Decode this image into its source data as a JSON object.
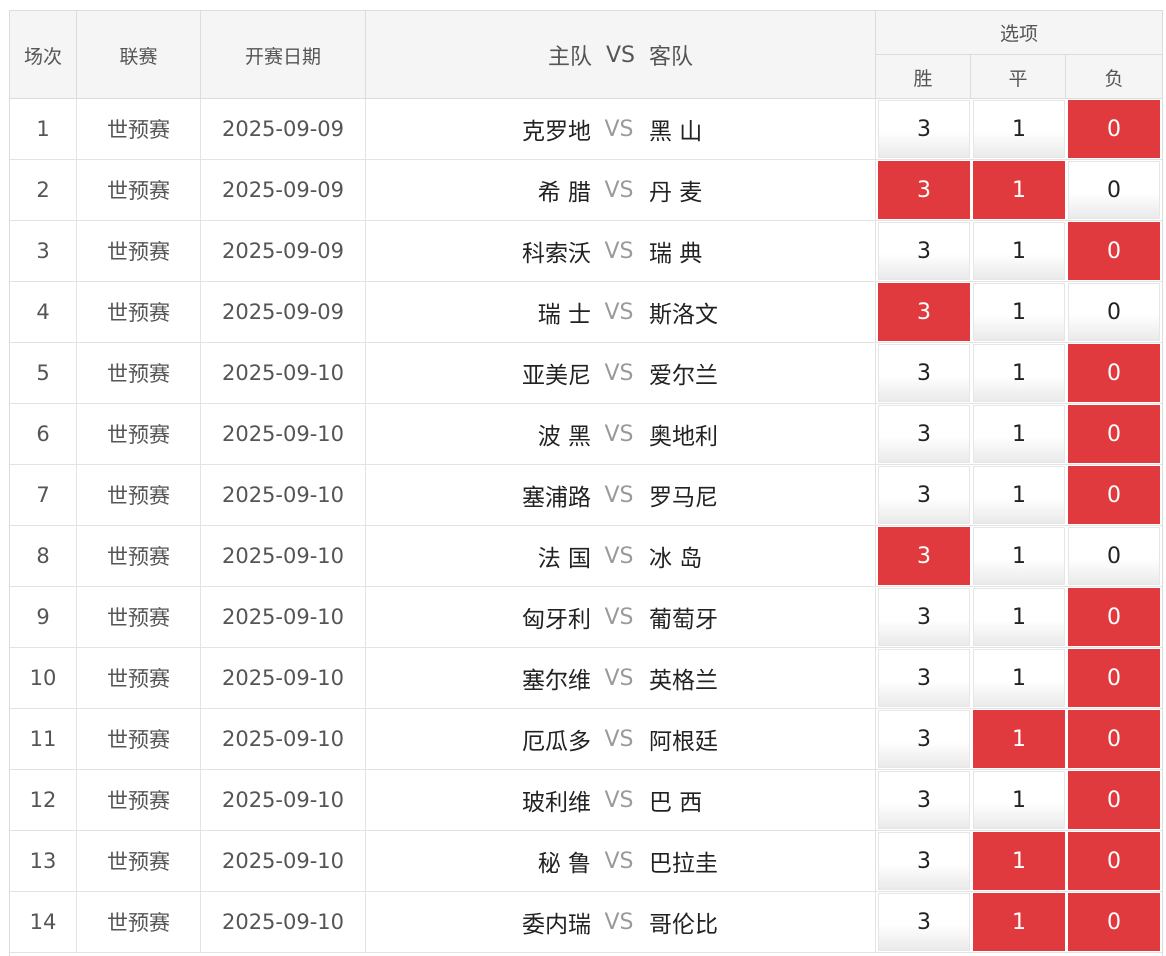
{
  "header": {
    "col_index": "场次",
    "col_league": "联赛",
    "col_date": "开赛日期",
    "col_home": "主队",
    "col_vs": "VS",
    "col_away": "客队",
    "options_title": "选项",
    "opt_win": "胜",
    "opt_draw": "平",
    "opt_loss": "负"
  },
  "colors": {
    "selected": "#e03a3e",
    "header_bg": "#f5f5f5"
  },
  "rows": [
    {
      "index": "1",
      "league": "世预赛",
      "date": "2025-09-09",
      "home": "克罗地",
      "vs": "VS",
      "away": "黑 山",
      "win": "3",
      "draw": "1",
      "loss": "0",
      "sel": [
        false,
        false,
        true
      ]
    },
    {
      "index": "2",
      "league": "世预赛",
      "date": "2025-09-09",
      "home": "希 腊",
      "vs": "VS",
      "away": "丹 麦",
      "win": "3",
      "draw": "1",
      "loss": "0",
      "sel": [
        true,
        true,
        false
      ]
    },
    {
      "index": "3",
      "league": "世预赛",
      "date": "2025-09-09",
      "home": "科索沃",
      "vs": "VS",
      "away": "瑞 典",
      "win": "3",
      "draw": "1",
      "loss": "0",
      "sel": [
        false,
        false,
        true
      ]
    },
    {
      "index": "4",
      "league": "世预赛",
      "date": "2025-09-09",
      "home": "瑞 士",
      "vs": "VS",
      "away": "斯洛文",
      "win": "3",
      "draw": "1",
      "loss": "0",
      "sel": [
        true,
        false,
        false
      ]
    },
    {
      "index": "5",
      "league": "世预赛",
      "date": "2025-09-10",
      "home": "亚美尼",
      "vs": "VS",
      "away": "爱尔兰",
      "win": "3",
      "draw": "1",
      "loss": "0",
      "sel": [
        false,
        false,
        true
      ]
    },
    {
      "index": "6",
      "league": "世预赛",
      "date": "2025-09-10",
      "home": "波 黑",
      "vs": "VS",
      "away": "奥地利",
      "win": "3",
      "draw": "1",
      "loss": "0",
      "sel": [
        false,
        false,
        true
      ]
    },
    {
      "index": "7",
      "league": "世预赛",
      "date": "2025-09-10",
      "home": "塞浦路",
      "vs": "VS",
      "away": "罗马尼",
      "win": "3",
      "draw": "1",
      "loss": "0",
      "sel": [
        false,
        false,
        true
      ]
    },
    {
      "index": "8",
      "league": "世预赛",
      "date": "2025-09-10",
      "home": "法 国",
      "vs": "VS",
      "away": "冰 岛",
      "win": "3",
      "draw": "1",
      "loss": "0",
      "sel": [
        true,
        false,
        false
      ]
    },
    {
      "index": "9",
      "league": "世预赛",
      "date": "2025-09-10",
      "home": "匈牙利",
      "vs": "VS",
      "away": "葡萄牙",
      "win": "3",
      "draw": "1",
      "loss": "0",
      "sel": [
        false,
        false,
        true
      ]
    },
    {
      "index": "10",
      "league": "世预赛",
      "date": "2025-09-10",
      "home": "塞尔维",
      "vs": "VS",
      "away": "英格兰",
      "win": "3",
      "draw": "1",
      "loss": "0",
      "sel": [
        false,
        false,
        true
      ]
    },
    {
      "index": "11",
      "league": "世预赛",
      "date": "2025-09-10",
      "home": "厄瓜多",
      "vs": "VS",
      "away": "阿根廷",
      "win": "3",
      "draw": "1",
      "loss": "0",
      "sel": [
        false,
        true,
        true
      ]
    },
    {
      "index": "12",
      "league": "世预赛",
      "date": "2025-09-10",
      "home": "玻利维",
      "vs": "VS",
      "away": "巴 西",
      "win": "3",
      "draw": "1",
      "loss": "0",
      "sel": [
        false,
        false,
        true
      ]
    },
    {
      "index": "13",
      "league": "世预赛",
      "date": "2025-09-10",
      "home": "秘 鲁",
      "vs": "VS",
      "away": "巴拉圭",
      "win": "3",
      "draw": "1",
      "loss": "0",
      "sel": [
        false,
        true,
        true
      ]
    },
    {
      "index": "14",
      "league": "世预赛",
      "date": "2025-09-10",
      "home": "委内瑞",
      "vs": "VS",
      "away": "哥伦比",
      "win": "3",
      "draw": "1",
      "loss": "0",
      "sel": [
        false,
        true,
        true
      ]
    }
  ]
}
